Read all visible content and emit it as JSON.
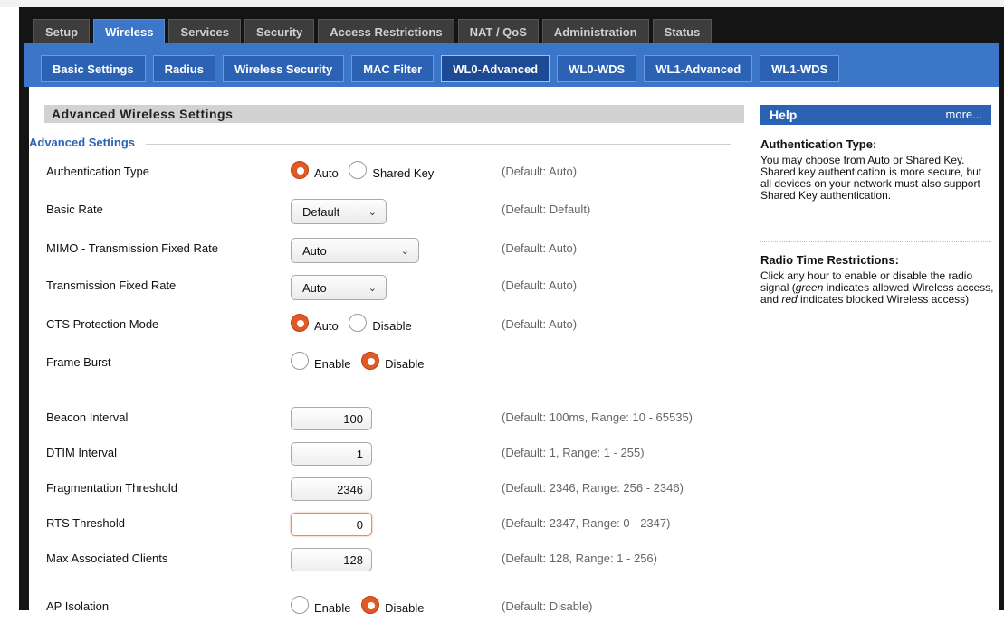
{
  "tabs_primary": [
    "Setup",
    "Wireless",
    "Services",
    "Security",
    "Access Restrictions",
    "NAT / QoS",
    "Administration",
    "Status"
  ],
  "tabs_secondary": [
    "Basic Settings",
    "Radius",
    "Wireless Security",
    "MAC Filter",
    "WL0-Advanced",
    "WL0-WDS",
    "WL1-Advanced",
    "WL1-WDS"
  ],
  "section_title": "Advanced Wireless Settings",
  "legend": "Advanced Settings",
  "settings": {
    "auth_type": {
      "label": "Authentication Type",
      "opt1": "Auto",
      "opt2": "Shared Key",
      "hint": "(Default: Auto)"
    },
    "basic_rate": {
      "label": "Basic Rate",
      "value": "Default",
      "hint": "(Default: Default)"
    },
    "mimo_rate": {
      "label": "MIMO - Transmission Fixed Rate",
      "value": "Auto",
      "hint": "(Default: Auto)"
    },
    "tx_rate": {
      "label": "Transmission Fixed Rate",
      "value": "Auto",
      "hint": "(Default: Auto)"
    },
    "cts": {
      "label": "CTS Protection Mode",
      "opt1": "Auto",
      "opt2": "Disable",
      "hint": "(Default: Auto)"
    },
    "frame_burst": {
      "label": "Frame Burst",
      "opt1": "Enable",
      "opt2": "Disable"
    },
    "beacon": {
      "label": "Beacon Interval",
      "value": "100",
      "hint": "(Default: 100ms, Range: 10 - 65535)"
    },
    "dtim": {
      "label": "DTIM Interval",
      "value": "1",
      "hint": "(Default: 1, Range: 1 - 255)"
    },
    "frag": {
      "label": "Fragmentation Threshold",
      "value": "2346",
      "hint": "(Default: 2346, Range: 256 - 2346)"
    },
    "rts": {
      "label": "RTS Threshold",
      "value": "0",
      "hint": "(Default: 2347, Range: 0 - 2347)"
    },
    "max_clients": {
      "label": "Max Associated Clients",
      "value": "128",
      "hint": "(Default: 128, Range: 1 - 256)"
    },
    "ap_isolation": {
      "label": "AP Isolation",
      "opt1": "Enable",
      "opt2": "Disable",
      "hint": "(Default: Disable)"
    }
  },
  "help": {
    "header": "Help",
    "more": "more...",
    "auth_title": "Authentication Type:",
    "auth_text": "You may choose from Auto or Shared Key. Shared key authentication is more secure, but all devices on your network must also support Shared Key authentication.",
    "radio_title": "Radio Time Restrictions:",
    "radio_text_1": "Click any hour to enable or disable the radio signal (",
    "radio_green": "green",
    "radio_text_2": " indicates allowed Wireless access, and ",
    "radio_red": "red",
    "radio_text_3": " indicates blocked Wireless access)"
  },
  "colors": {
    "accent": "#3b76c8",
    "radio_selected": "#e05a25",
    "legend": "#2d63b5"
  }
}
